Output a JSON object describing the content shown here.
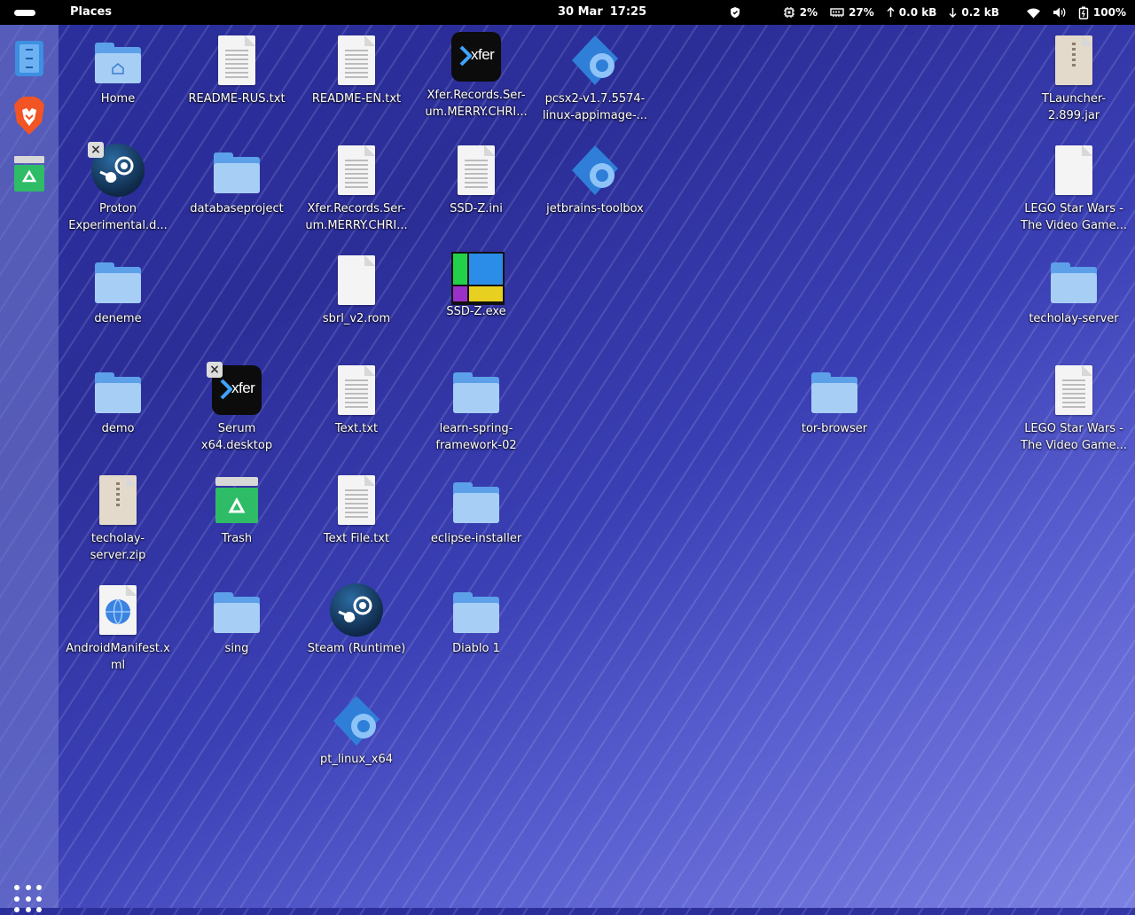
{
  "topbar": {
    "places_label": "Places",
    "date": "30 Mar",
    "time": "17:25",
    "cpu": "2%",
    "memory": "27%",
    "upload": "0.0 kB",
    "download": "0.2 kB",
    "battery": "100%"
  },
  "desktop": {
    "items": [
      {
        "label": "Home"
      },
      {
        "label": "README-RUS.txt"
      },
      {
        "label": "README-EN.txt"
      },
      {
        "label": "Xfer.Records.Ser-um.MERRY.CHRI..."
      },
      {
        "label": "pcsx2-v1.7.5574-linux-appimage-..."
      },
      {
        "label": "TLauncher-2.899.jar"
      },
      {
        "label": "Proton Experimental.d..."
      },
      {
        "label": "databaseproject"
      },
      {
        "label": "Xfer.Records.Ser-um.MERRY.CHRI..."
      },
      {
        "label": "SSD-Z.ini"
      },
      {
        "label": "jetbrains-toolbox"
      },
      {
        "label": "LEGO Star Wars - The Video Game..."
      },
      {
        "label": "deneme"
      },
      {
        "label": "sbrl_v2.rom"
      },
      {
        "label": "SSD-Z.exe"
      },
      {
        "label": "techolay-server"
      },
      {
        "label": "demo"
      },
      {
        "label": "Serum x64.desktop"
      },
      {
        "label": "Text.txt"
      },
      {
        "label": "learn-spring-framework-02"
      },
      {
        "label": "tor-browser"
      },
      {
        "label": "LEGO Star Wars - The Video Game..."
      },
      {
        "label": "techolay-server.zip"
      },
      {
        "label": "Trash"
      },
      {
        "label": "Text File.txt"
      },
      {
        "label": "eclipse-installer"
      },
      {
        "label": "AndroidManifest.xml"
      },
      {
        "label": "sing"
      },
      {
        "label": "Steam (Runtime)"
      },
      {
        "label": "Diablo 1"
      },
      {
        "label": "pt_linux_x64"
      }
    ]
  },
  "colors": {
    "folder": "#a7cef5",
    "folder_back": "#5da0ea",
    "topbar": "#000000",
    "trash_green": "#2ebc67"
  }
}
